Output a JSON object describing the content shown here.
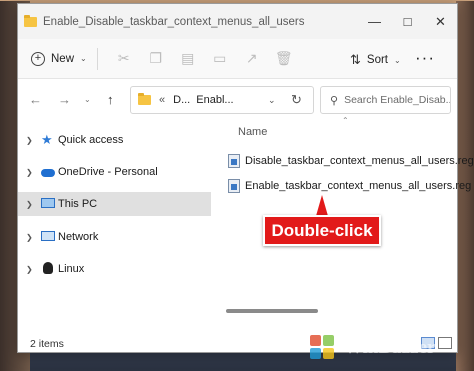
{
  "window": {
    "title": "Enable_Disable_taskbar_context_menus_all_users"
  },
  "toolbar": {
    "new_label": "New",
    "sort_label": "Sort",
    "more_label": "···"
  },
  "address": {
    "overflow": "«",
    "seg1": "D...",
    "seg2": "Enabl..."
  },
  "search": {
    "placeholder": "Search Enable_Disab..."
  },
  "sidebar": {
    "items": [
      {
        "label": "Quick access",
        "icon": "star-icon"
      },
      {
        "label": "OneDrive - Personal",
        "icon": "cloud-icon"
      },
      {
        "label": "This PC",
        "icon": "monitor-icon",
        "selected": true
      },
      {
        "label": "Network",
        "icon": "network-icon"
      },
      {
        "label": "Linux",
        "icon": "penguin-icon"
      }
    ]
  },
  "main": {
    "column_name": "Name",
    "files": [
      {
        "name": "Disable_taskbar_context_menus_all_users.reg",
        "icon": "registry-file-icon"
      },
      {
        "name": "Enable_taskbar_context_menus_all_users.reg",
        "icon": "registry-file-icon"
      }
    ]
  },
  "callout": {
    "text": "Double-click",
    "color": "#e21a1a"
  },
  "status": {
    "items_count": "2 items"
  },
  "watermark": {
    "text": "WinBuzzer"
  }
}
